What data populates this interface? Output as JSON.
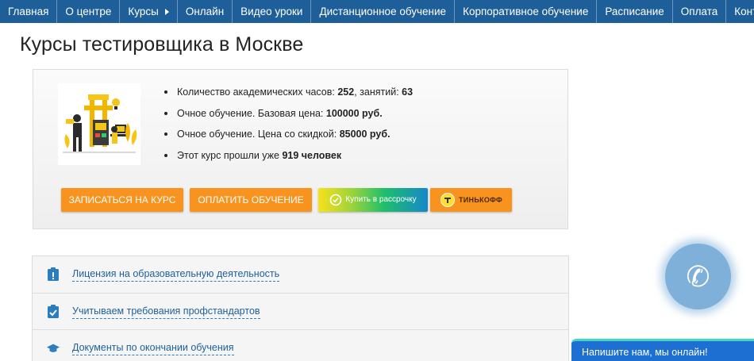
{
  "nav": {
    "items": [
      {
        "label": "Главная"
      },
      {
        "label": "О центре"
      },
      {
        "label": "Курсы"
      },
      {
        "label": "Онлайн"
      },
      {
        "label": "Видео уроки"
      },
      {
        "label": "Дистанционное обучение"
      },
      {
        "label": "Корпоративное обучение"
      },
      {
        "label": "Расписание"
      },
      {
        "label": "Оплата"
      },
      {
        "label": "Контакты"
      }
    ],
    "background": "#1f5f99"
  },
  "page": {
    "title": "Курсы тестировщика в Москве"
  },
  "course": {
    "facts": [
      {
        "prefix": "Количество академических часов: ",
        "v1": "252",
        "mid": ", занятий: ",
        "v2": "63"
      },
      {
        "prefix": "Очное обучение. Базовая цена: ",
        "v1": "100000 руб."
      },
      {
        "prefix": "Очное обучение. Цена со скидкой: ",
        "v1": "85000 руб."
      },
      {
        "prefix": "Этот курс прошли уже ",
        "v1": "919 человек"
      }
    ],
    "buttons": {
      "enroll": "ЗАПИСАТЬСЯ НА КУРС",
      "pay": "ОПЛАТИТЬ ОБУЧЕНИЕ",
      "installment": "Купить в рассрочку",
      "tinkoff": "ТИНЬКОФФ"
    },
    "accent": "#f7931e"
  },
  "info": {
    "items": [
      {
        "label": "Лицензия на образовательную деятельность",
        "icon": "clipboard-alert-icon"
      },
      {
        "label": "Учитываем требования профстандартов",
        "icon": "clipboard-check-icon"
      },
      {
        "label": "Документы по окончании обучения",
        "icon": "graduation-cap-icon"
      }
    ]
  },
  "widgets": {
    "phone_icon": "phone-icon",
    "chat_label": "Напишите нам, мы онлайн!"
  }
}
